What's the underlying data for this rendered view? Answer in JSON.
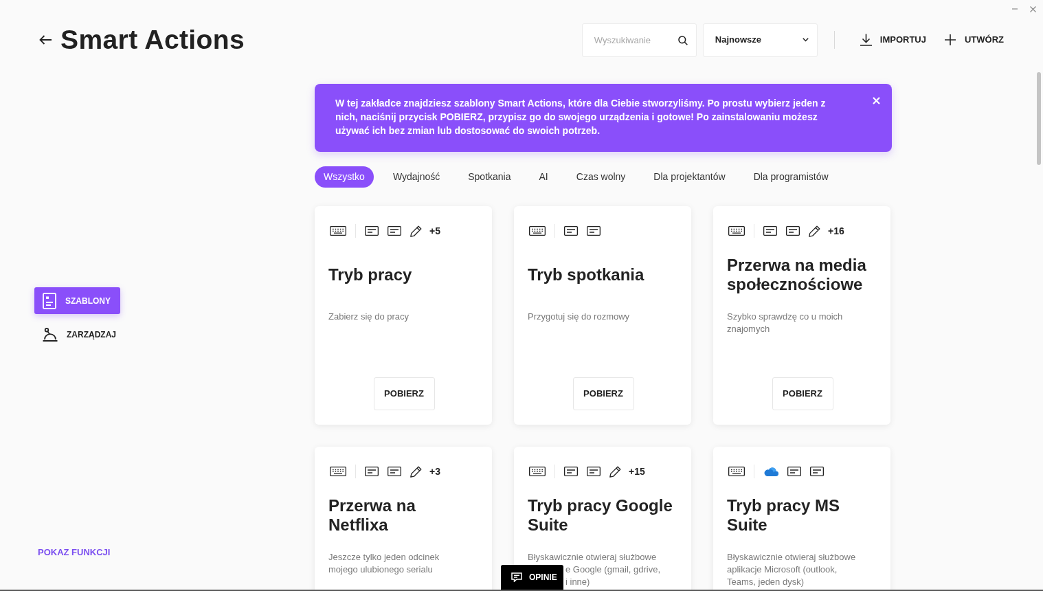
{
  "window": {
    "controls": [
      {
        "kind": "minimize"
      },
      {
        "kind": "close"
      }
    ]
  },
  "header": {
    "title": "Smart Actions",
    "search": {
      "placeholder": "Wyszukiwanie"
    },
    "sort": {
      "value": "Najnowsze"
    },
    "actions": [
      {
        "kind": "import",
        "label": "IMPORTUJ"
      },
      {
        "kind": "create",
        "label": "UTWÓRZ"
      }
    ]
  },
  "sidebar": {
    "items": [
      {
        "kind": "templates",
        "label": "SZABLONY",
        "selected": true
      },
      {
        "kind": "manage",
        "label": "ZARZĄDZAJ",
        "selected": false
      }
    ],
    "footer_link": "POKAZ FUNKCJI"
  },
  "banner": {
    "text": "W tej zakładce znajdziesz szablony Smart Actions, które dla Ciebie stworzyliśmy. Po prostu wybierz jeden z nich, naciśnij przycisk POBIERZ, przypisz go do swojego urządzenia i gotowe! Po zainstalowaniu możesz używać ich bez zmian lub dostosować do swoich potrzeb."
  },
  "tabs": [
    {
      "label": "Wszystko",
      "selected": true
    },
    {
      "label": "Wydajność",
      "selected": false
    },
    {
      "label": "Spotkania",
      "selected": false
    },
    {
      "label": "AI",
      "selected": false
    },
    {
      "label": "Czas wolny",
      "selected": false
    },
    {
      "label": "Dla projektantów",
      "selected": false
    },
    {
      "label": "Dla programistów",
      "selected": false
    }
  ],
  "cards": [
    {
      "trigger": {
        "kind": "keyboard"
      },
      "actions": [
        {
          "kind": "note"
        },
        {
          "kind": "note"
        },
        {
          "kind": "pencil"
        }
      ],
      "more": "+5",
      "title": "Tryb pracy",
      "description": "Zabierz się do pracy",
      "button": "POBIERZ"
    },
    {
      "trigger": {
        "kind": "keyboard"
      },
      "actions": [
        {
          "kind": "note"
        },
        {
          "kind": "note"
        }
      ],
      "title": "Tryb spotkania",
      "description": "Przygotuj się do rozmowy",
      "button": "POBIERZ"
    },
    {
      "trigger": {
        "kind": "keyboard"
      },
      "actions": [
        {
          "kind": "note"
        },
        {
          "kind": "note"
        },
        {
          "kind": "pencil"
        }
      ],
      "more": "+16",
      "title": "Przerwa na media społecznościowe",
      "description": "Szybko sprawdzę co u moich znajomych",
      "button": "POBIERZ"
    },
    {
      "trigger": {
        "kind": "keyboard"
      },
      "actions": [
        {
          "kind": "note"
        },
        {
          "kind": "note"
        },
        {
          "kind": "pencil"
        }
      ],
      "more": "+3",
      "title": "Przerwa na Netflixa",
      "description": "Jeszcze tylko jeden odcinek mojego ulubionego serialu"
    },
    {
      "trigger": {
        "kind": "keyboard"
      },
      "actions": [
        {
          "kind": "note"
        },
        {
          "kind": "note"
        },
        {
          "kind": "pencil"
        }
      ],
      "more": "+15",
      "title": "Tryb pracy Google Suite",
      "description": "Błyskawicznie otwieraj służbowe",
      "covered_lines": [
        "e Google (gmail, gdrive,",
        "i inne)"
      ]
    },
    {
      "trigger": {
        "kind": "keyboard"
      },
      "actions": [
        {
          "kind": "cloud"
        },
        {
          "kind": "note"
        },
        {
          "kind": "note"
        }
      ],
      "title": "Tryb pracy MS Suite",
      "description": "Błyskawicznie otwieraj służbowe aplikacje Microsoft (outlook, Teams, jeden dysk)"
    }
  ],
  "feedback_button": {
    "label": "OPINIE"
  }
}
